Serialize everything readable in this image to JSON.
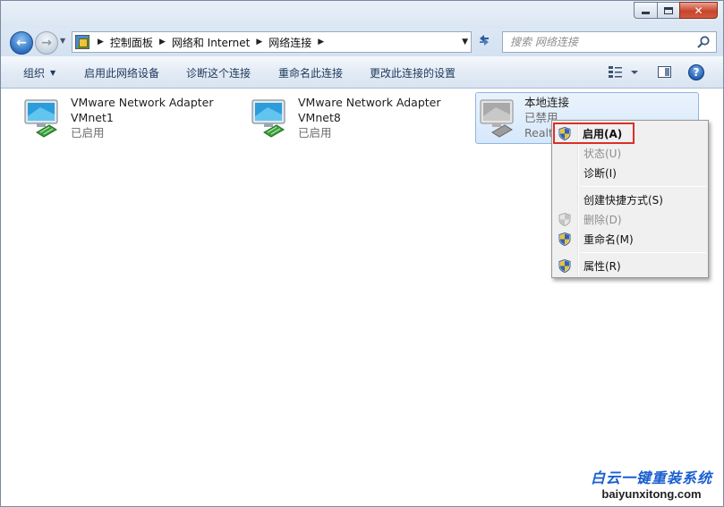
{
  "titlebar": {
    "minimize_icon": "minimize-icon",
    "maximize_icon": "maximize-icon",
    "close_icon": "close-icon",
    "close_glyph": "✕"
  },
  "nav": {
    "back_glyph": "←",
    "forward_glyph": "→",
    "breadcrumbs": [
      "控制面板",
      "网络和 Internet",
      "网络连接"
    ],
    "search_placeholder": "搜索 网络连接"
  },
  "toolbar": {
    "organize": "组织",
    "enable_device": "启用此网络设备",
    "diagnose": "诊断这个连接",
    "rename": "重命名此连接",
    "change_settings": "更改此连接的设置",
    "help_glyph": "?"
  },
  "adapters": [
    {
      "name": "VMware Network Adapter",
      "subname": "VMnet1",
      "status": "已启用",
      "state": "enabled"
    },
    {
      "name": "VMware Network Adapter",
      "subname": "VMnet8",
      "status": "已启用",
      "state": "enabled"
    },
    {
      "name": "本地连接",
      "subname": "已禁用",
      "status": "Realt",
      "state": "disabled"
    }
  ],
  "context_menu": {
    "items": [
      {
        "label": "启用(A)",
        "shield": true,
        "disabled": false,
        "default": true
      },
      {
        "label": "状态(U)",
        "shield": false,
        "disabled": true,
        "default": false
      },
      {
        "label": "诊断(I)",
        "shield": false,
        "disabled": false,
        "default": false
      },
      {
        "label": "创建快捷方式(S)",
        "shield": false,
        "disabled": false,
        "default": false
      },
      {
        "label": "删除(D)",
        "shield": true,
        "disabled": true,
        "default": false
      },
      {
        "label": "重命名(M)",
        "shield": true,
        "disabled": false,
        "default": false
      },
      {
        "label": "属性(R)",
        "shield": true,
        "disabled": false,
        "default": false
      }
    ]
  },
  "watermark": {
    "brand": "白云一键重装系统",
    "domain": "baiyunxitong.com"
  },
  "colors": {
    "accent": "#1e395b",
    "highlight_border": "#d9302b",
    "selection": "#d6e8fb"
  }
}
